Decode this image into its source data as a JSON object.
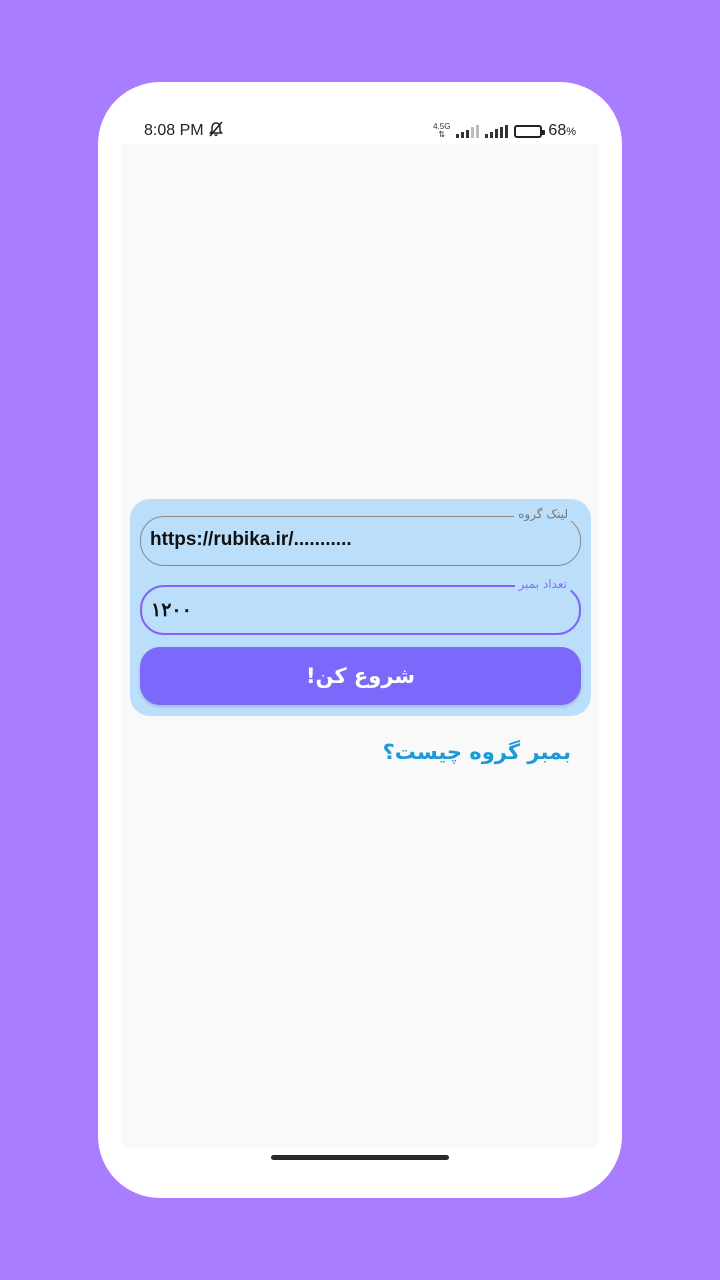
{
  "status": {
    "time": "8:08 PM",
    "network": "4.5G",
    "battery": "68",
    "battery_unit": "%",
    "battery_level": 0.68
  },
  "form": {
    "link_label": "لینک گروه",
    "link_value": "https://rubika.ir/...........",
    "count_label": "تعداد بمبر",
    "count_value": "۱۲۰۰",
    "start_button": "شروع کن!"
  },
  "help_link": "بمبر گروه چیست؟",
  "colors": {
    "background": "#a87dff",
    "card": "#bbdefa",
    "accent": "#7c68fb",
    "link": "#1b9ad8"
  }
}
